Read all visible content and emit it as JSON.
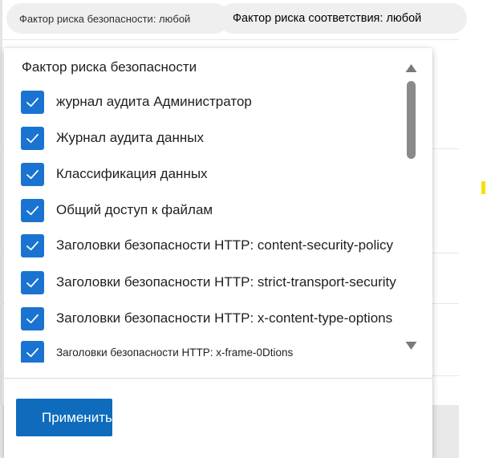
{
  "filters": {
    "security_pill": "Фактор риска безопасности: любой",
    "compliance_pill": "Фактор риска соответствия: любой"
  },
  "popup": {
    "title": "Фактор риска безопасности",
    "options": [
      {
        "label": "журнал аудита Администратор",
        "checked": true
      },
      {
        "label": "Журнал аудита данных",
        "checked": true
      },
      {
        "label": "Классификация данных",
        "checked": true
      },
      {
        "label": "Общий доступ к файлам",
        "checked": true
      },
      {
        "label": "Заголовки безопасности HTTP: content-security-policy",
        "checked": true
      },
      {
        "label": "Заголовки безопасности HTTP: strict-transport-security",
        "checked": true
      },
      {
        "label": "Заголовки безопасности HTTP: x-content-type-options",
        "checked": true
      },
      {
        "label": "Заголовки безопасности HTTP: x-frame-0Dtions",
        "checked": true
      }
    ],
    "apply_label": "Применить"
  },
  "colors": {
    "accent": "#0f6cbd",
    "checkbox": "#1a73d0"
  }
}
